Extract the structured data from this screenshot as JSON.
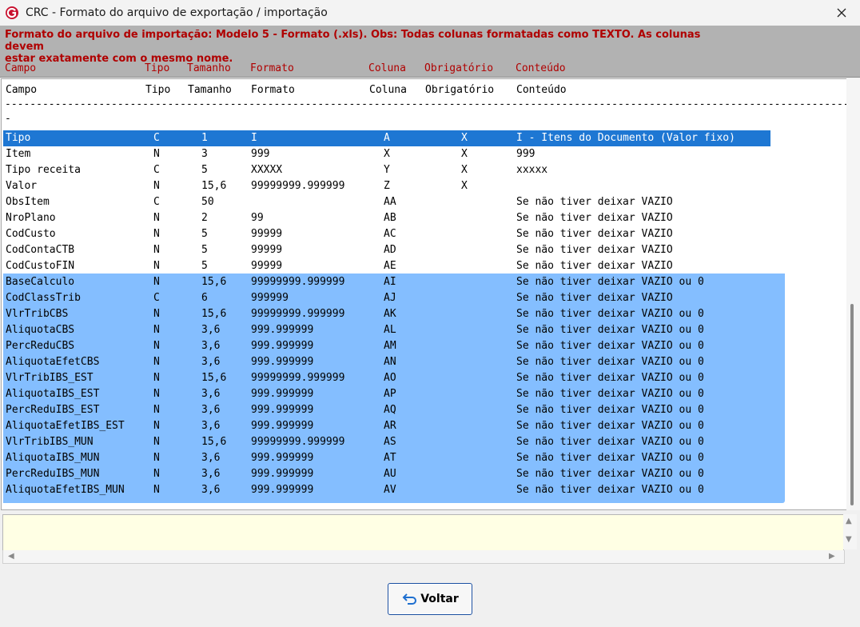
{
  "window": {
    "title": "CRC - Formato do arquivo de exportação / importação",
    "icon": "crc-logo-icon",
    "close_icon": "close-icon"
  },
  "notice": {
    "line1": "Formato do arquivo de importação: Modelo 5 - Formato (.xls). Obs: Todas colunas formatadas como TEXTO. As colunas devem",
    "line2": "estar exatamente com o mesmo nome.",
    "color": "#b00000"
  },
  "columns": {
    "campo": "Campo",
    "tipo": "Tipo",
    "tamanho": "Tamanho",
    "formato": "Formato",
    "coluna": "Coluna",
    "obrigatorio": "Obrigatório",
    "conteudo": "Conteúdo"
  },
  "separator": "----------------------------------------------------------------------------------------------------------------------------------------",
  "separator_tail": "-",
  "rows": [
    {
      "campo": "Tipo",
      "tipo": "C",
      "tamanho": "1",
      "formato": "I",
      "coluna": "A",
      "obrig": "X",
      "conteudo": "I - Itens do Documento (Valor fixo)"
    },
    {
      "campo": "Item",
      "tipo": "N",
      "tamanho": "3",
      "formato": "999",
      "coluna": "X",
      "obrig": "X",
      "conteudo": "999"
    },
    {
      "campo": "Tipo receita",
      "tipo": "C",
      "tamanho": "5",
      "formato": "XXXXX",
      "coluna": "Y",
      "obrig": "X",
      "conteudo": "xxxxx"
    },
    {
      "campo": "Valor",
      "tipo": "N",
      "tamanho": "15,6",
      "formato": "99999999.999999",
      "coluna": "Z",
      "obrig": "X",
      "conteudo": ""
    },
    {
      "campo": "ObsItem",
      "tipo": "C",
      "tamanho": "50",
      "formato": "",
      "coluna": "AA",
      "obrig": "",
      "conteudo": "Se não tiver deixar VAZIO"
    },
    {
      "campo": "NroPlano",
      "tipo": "N",
      "tamanho": "2",
      "formato": "99",
      "coluna": "AB",
      "obrig": "",
      "conteudo": "Se não tiver deixar VAZIO"
    },
    {
      "campo": "CodCusto",
      "tipo": "N",
      "tamanho": "5",
      "formato": "99999",
      "coluna": "AC",
      "obrig": "",
      "conteudo": "Se não tiver deixar VAZIO"
    },
    {
      "campo": "CodContaCTB",
      "tipo": "N",
      "tamanho": "5",
      "formato": "99999",
      "coluna": "AD",
      "obrig": "",
      "conteudo": "Se não tiver deixar VAZIO"
    },
    {
      "campo": "CodCustoFIN",
      "tipo": "N",
      "tamanho": "5",
      "formato": "99999",
      "coluna": "AE",
      "obrig": "",
      "conteudo": "Se não tiver deixar VAZIO"
    },
    {
      "campo": "BaseCalculo",
      "tipo": "N",
      "tamanho": "15,6",
      "formato": "99999999.999999",
      "coluna": "AI",
      "obrig": "",
      "conteudo": "Se não tiver deixar VAZIO ou 0"
    },
    {
      "campo": "CodClassTrib",
      "tipo": "C",
      "tamanho": "6",
      "formato": "999999",
      "coluna": "AJ",
      "obrig": "",
      "conteudo": "Se não tiver deixar VAZIO"
    },
    {
      "campo": "VlrTribCBS",
      "tipo": "N",
      "tamanho": "15,6",
      "formato": "99999999.999999",
      "coluna": "AK",
      "obrig": "",
      "conteudo": "Se não tiver deixar VAZIO ou 0"
    },
    {
      "campo": "AliquotaCBS",
      "tipo": "N",
      "tamanho": "3,6",
      "formato": "999.999999",
      "coluna": "AL",
      "obrig": "",
      "conteudo": "Se não tiver deixar VAZIO ou 0"
    },
    {
      "campo": "PercReduCBS",
      "tipo": "N",
      "tamanho": "3,6",
      "formato": "999.999999",
      "coluna": "AM",
      "obrig": "",
      "conteudo": "Se não tiver deixar VAZIO ou 0"
    },
    {
      "campo": "AliquotaEfetCBS",
      "tipo": "N",
      "tamanho": "3,6",
      "formato": "999.999999",
      "coluna": "AN",
      "obrig": "",
      "conteudo": "Se não tiver deixar VAZIO ou 0"
    },
    {
      "campo": "VlrTribIBS_EST",
      "tipo": "N",
      "tamanho": "15,6",
      "formato": "99999999.999999",
      "coluna": "AO",
      "obrig": "",
      "conteudo": "Se não tiver deixar VAZIO ou 0"
    },
    {
      "campo": "AliquotaIBS_EST",
      "tipo": "N",
      "tamanho": "3,6",
      "formato": "999.999999",
      "coluna": "AP",
      "obrig": "",
      "conteudo": "Se não tiver deixar VAZIO ou 0"
    },
    {
      "campo": "PercReduIBS_EST",
      "tipo": "N",
      "tamanho": "3,6",
      "formato": "999.999999",
      "coluna": "AQ",
      "obrig": "",
      "conteudo": "Se não tiver deixar VAZIO ou 0"
    },
    {
      "campo": "AliquotaEfetIBS_EST",
      "tipo": "N",
      "tamanho": "3,6",
      "formato": "999.999999",
      "coluna": "AR",
      "obrig": "",
      "conteudo": "Se não tiver deixar VAZIO ou 0"
    },
    {
      "campo": "VlrTribIBS_MUN",
      "tipo": "N",
      "tamanho": "15,6",
      "formato": "99999999.999999",
      "coluna": "AS",
      "obrig": "",
      "conteudo": "Se não tiver deixar VAZIO ou 0"
    },
    {
      "campo": "AliquotaIBS_MUN",
      "tipo": "N",
      "tamanho": "3,6",
      "formato": "999.999999",
      "coluna": "AT",
      "obrig": "",
      "conteudo": "Se não tiver deixar VAZIO ou 0"
    },
    {
      "campo": "PercReduIBS_MUN",
      "tipo": "N",
      "tamanho": "3,6",
      "formato": "999.999999",
      "coluna": "AU",
      "obrig": "",
      "conteudo": "Se não tiver deixar VAZIO ou 0"
    },
    {
      "campo": "AliquotaEfetIBS_MUN",
      "tipo": "N",
      "tamanho": "3,6",
      "formato": "999.999999",
      "coluna": "AV",
      "obrig": "",
      "conteudo": "Se não tiver deixar VAZIO ou 0"
    }
  ],
  "memo": {
    "value": ""
  },
  "button": {
    "label": "Voltar",
    "icon": "undo-arrow-icon"
  },
  "colors": {
    "header_text": "#b00000",
    "selected_row": "#1e77d3",
    "highlight_block": "#84beff",
    "memo_bg": "#ffffe4"
  }
}
